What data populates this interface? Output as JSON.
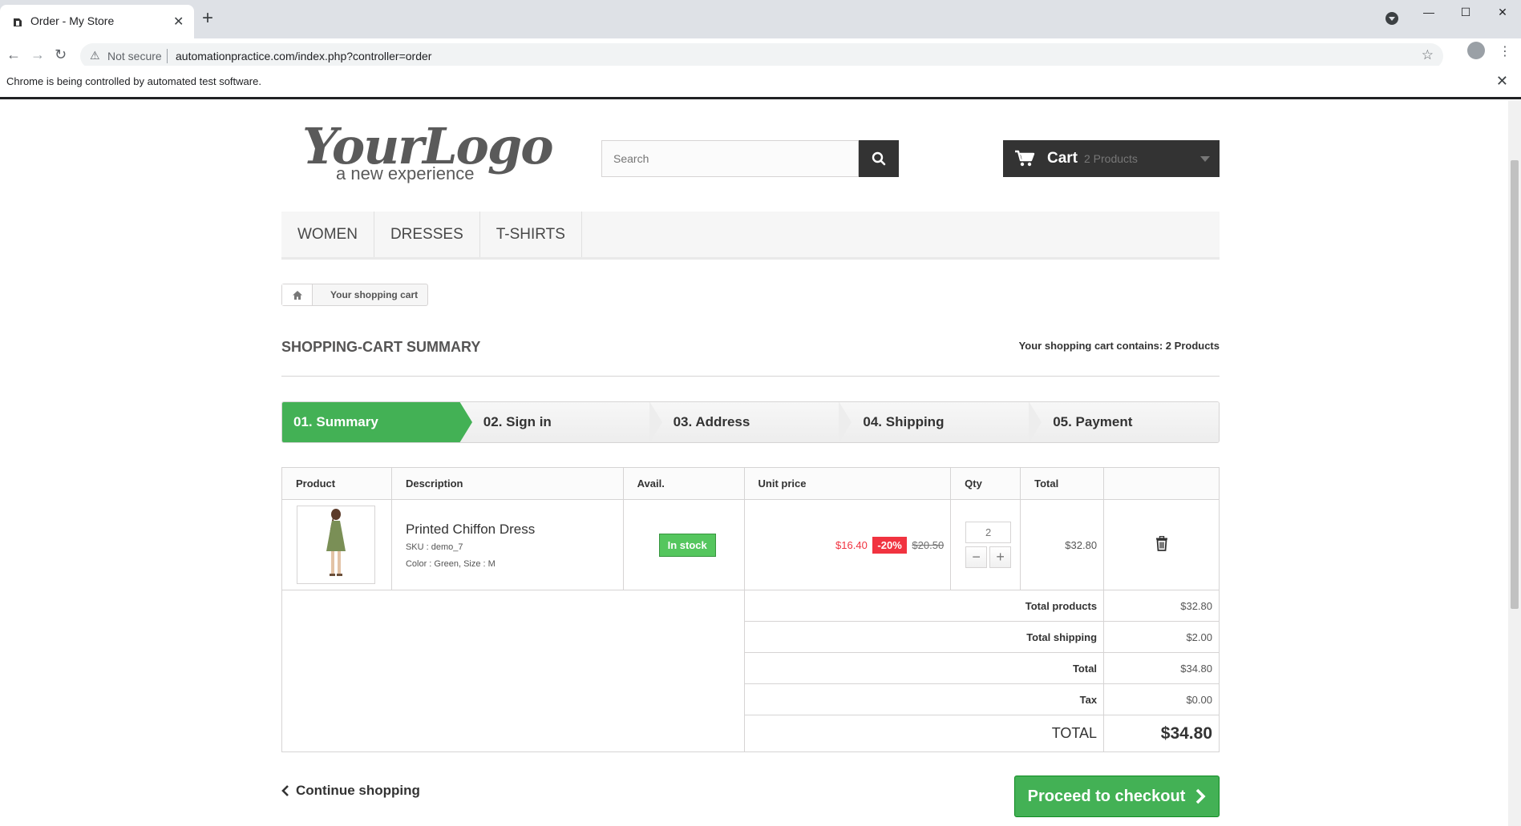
{
  "browser": {
    "tab_title": "Order - My Store",
    "url": "automationpractice.com/index.php?controller=order",
    "security_text": "Not secure",
    "infobar_message": "Chrome is being controlled by automated test software."
  },
  "header": {
    "logo_main": "YourLogo",
    "logo_sub": "a new experience",
    "search_placeholder": "Search",
    "cart_label": "Cart",
    "cart_count": "2 Products"
  },
  "menu": {
    "items": [
      "Women",
      "Dresses",
      "T-shirts"
    ]
  },
  "breadcrumb": {
    "current": "Your shopping cart"
  },
  "page": {
    "title": "Shopping-cart summary",
    "cart_count_text": "Your shopping cart contains: 2 Products"
  },
  "steps": [
    "01. Summary",
    "02. Sign in",
    "03. Address",
    "04. Shipping",
    "05. Payment"
  ],
  "table": {
    "headers": {
      "product": "Product",
      "description": "Description",
      "avail": "Avail.",
      "unit_price": "Unit price",
      "qty": "Qty",
      "total": "Total"
    },
    "rows": [
      {
        "name": "Printed Chiffon Dress",
        "sku": "SKU : demo_7",
        "attributes": "Color : Green, Size : M",
        "availability": "In stock",
        "price_new": "$16.40",
        "price_reduction": "-20%",
        "price_old": "$20.50",
        "qty": "2",
        "total": "$32.80"
      }
    ],
    "summary": {
      "total_products_label": "Total products",
      "total_products_value": "$32.80",
      "total_shipping_label": "Total shipping",
      "total_shipping_value": "$2.00",
      "total_label": "Total",
      "total_value": "$34.80",
      "tax_label": "Tax",
      "tax_value": "$0.00",
      "grand_total_label": "Total",
      "grand_total_value": "$34.80"
    }
  },
  "actions": {
    "continue_label": "Continue shopping",
    "checkout_label": "Proceed to checkout"
  },
  "colors": {
    "accent_green": "#43b155",
    "price_red": "#f13340",
    "dark": "#333333"
  }
}
